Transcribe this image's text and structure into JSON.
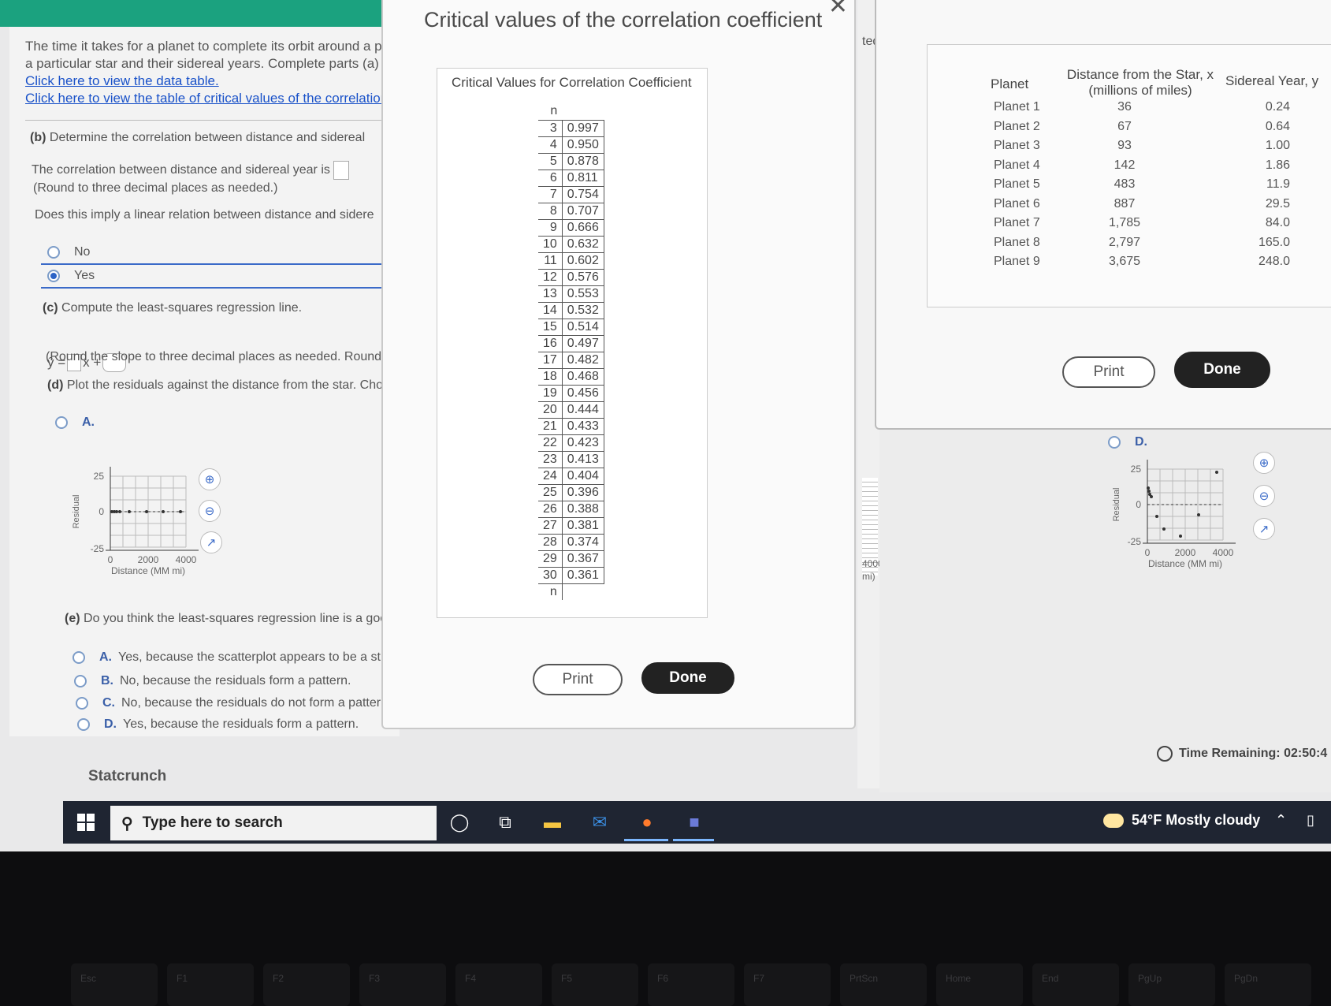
{
  "question": {
    "intro_line1": "The time it takes for a planet to complete its orbit around a p",
    "intro_line2": "a particular star and their sidereal years. Complete parts (a)",
    "link_data": "Click here to view the data table.",
    "link_critical": "Click here to view the table of critical values of the correlation",
    "part_b_label": "(b)",
    "part_b_text": "Determine the correlation between distance and sidereal",
    "corr_prompt": "The correlation between distance and sidereal year is",
    "corr_round": "(Round to three decimal places as needed.)",
    "linear_q": "Does this imply a linear relation between distance and sidere",
    "opt_no": "No",
    "opt_yes": "Yes",
    "part_c_label": "(c)",
    "part_c_text": "Compute the least-squares regression line.",
    "eq_yhat": "ŷ =",
    "eq_x": "x +",
    "eq_round": "(Round the slope to three decimal places as needed. Round",
    "part_d_label": "(d)",
    "part_d_text": "Plot the residuals against the distance from the star. Cho",
    "choice_a": "A.",
    "part_e_label": "(e)",
    "part_e_text": "Do you think the least-squares regression line is a good r",
    "e_opts": [
      {
        "letter": "A.",
        "text": "Yes, because the scatterplot appears to be a straight"
      },
      {
        "letter": "B.",
        "text": "No, because the residuals form a pattern."
      },
      {
        "letter": "C.",
        "text": "No, because the residuals do not form a pattern."
      },
      {
        "letter": "D.",
        "text": "Yes, because the residuals form a pattern."
      }
    ]
  },
  "mini_plot_a": {
    "ylabel": "Residual",
    "xlabel": "Distance (MM mi)",
    "yticks": [
      "25",
      "0",
      "-25"
    ],
    "xticks": [
      "0",
      "2000",
      "4000"
    ]
  },
  "mini_plot_d": {
    "choice": "D.",
    "ylabel": "Residual",
    "xlabel": "Distance (MM mi)",
    "yticks": [
      "25",
      "0",
      "-25"
    ],
    "xticks": [
      "0",
      "2000",
      "4000"
    ]
  },
  "modal": {
    "title": "Critical values of the correlation coefficient",
    "box_title": "Critical Values for Correlation Coefficient",
    "n_label": "n",
    "rows": [
      [
        "3",
        "0.997"
      ],
      [
        "4",
        "0.950"
      ],
      [
        "5",
        "0.878"
      ],
      [
        "6",
        "0.811"
      ],
      [
        "7",
        "0.754"
      ],
      [
        "8",
        "0.707"
      ],
      [
        "9",
        "0.666"
      ],
      [
        "10",
        "0.632"
      ],
      [
        "11",
        "0.602"
      ],
      [
        "12",
        "0.576"
      ],
      [
        "13",
        "0.553"
      ],
      [
        "14",
        "0.532"
      ],
      [
        "15",
        "0.514"
      ],
      [
        "16",
        "0.497"
      ],
      [
        "17",
        "0.482"
      ],
      [
        "18",
        "0.468"
      ],
      [
        "19",
        "0.456"
      ],
      [
        "20",
        "0.444"
      ],
      [
        "21",
        "0.433"
      ],
      [
        "22",
        "0.423"
      ],
      [
        "23",
        "0.413"
      ],
      [
        "24",
        "0.404"
      ],
      [
        "25",
        "0.396"
      ],
      [
        "26",
        "0.388"
      ],
      [
        "27",
        "0.381"
      ],
      [
        "28",
        "0.374"
      ],
      [
        "29",
        "0.367"
      ],
      [
        "30",
        "0.361"
      ]
    ],
    "print": "Print",
    "done": "Done"
  },
  "middle": {
    "ted": "ted",
    "x4000": "4000",
    "mi": "mi)"
  },
  "data_table": {
    "col_planet": "Planet",
    "col_dist_1": "Distance from the Star, x",
    "col_dist_2": "(millions of miles)",
    "col_year": "Sidereal Year, y",
    "rows": [
      [
        "Planet 1",
        "36",
        "0.24"
      ],
      [
        "Planet 2",
        "67",
        "0.64"
      ],
      [
        "Planet 3",
        "93",
        "1.00"
      ],
      [
        "Planet 4",
        "142",
        "1.86"
      ],
      [
        "Planet 5",
        "483",
        "11.9"
      ],
      [
        "Planet 6",
        "887",
        "29.5"
      ],
      [
        "Planet 7",
        "1,785",
        "84.0"
      ],
      [
        "Planet 8",
        "2,797",
        "165.0"
      ],
      [
        "Planet 9",
        "3,675",
        "248.0"
      ]
    ],
    "print": "Print",
    "done": "Done"
  },
  "status": {
    "time_remaining": "Time Remaining: 02:50:4",
    "statcrunch": "Statcrunch"
  },
  "taskbar": {
    "search_placeholder": "Type here to search",
    "weather": "54°F  Mostly cloudy"
  },
  "keyboard": {
    "keys": [
      "Esc",
      "F1",
      "F2",
      "F3",
      "F4",
      "F5",
      "F6",
      "F7",
      "PrtScn",
      "Home",
      "End",
      "PgUp",
      "PgDn"
    ]
  },
  "colors": {
    "accent_green": "#1ba27f",
    "link_blue": "#1a52c9",
    "selected_blue": "#2b63c6",
    "taskbar": "#1f2532"
  }
}
